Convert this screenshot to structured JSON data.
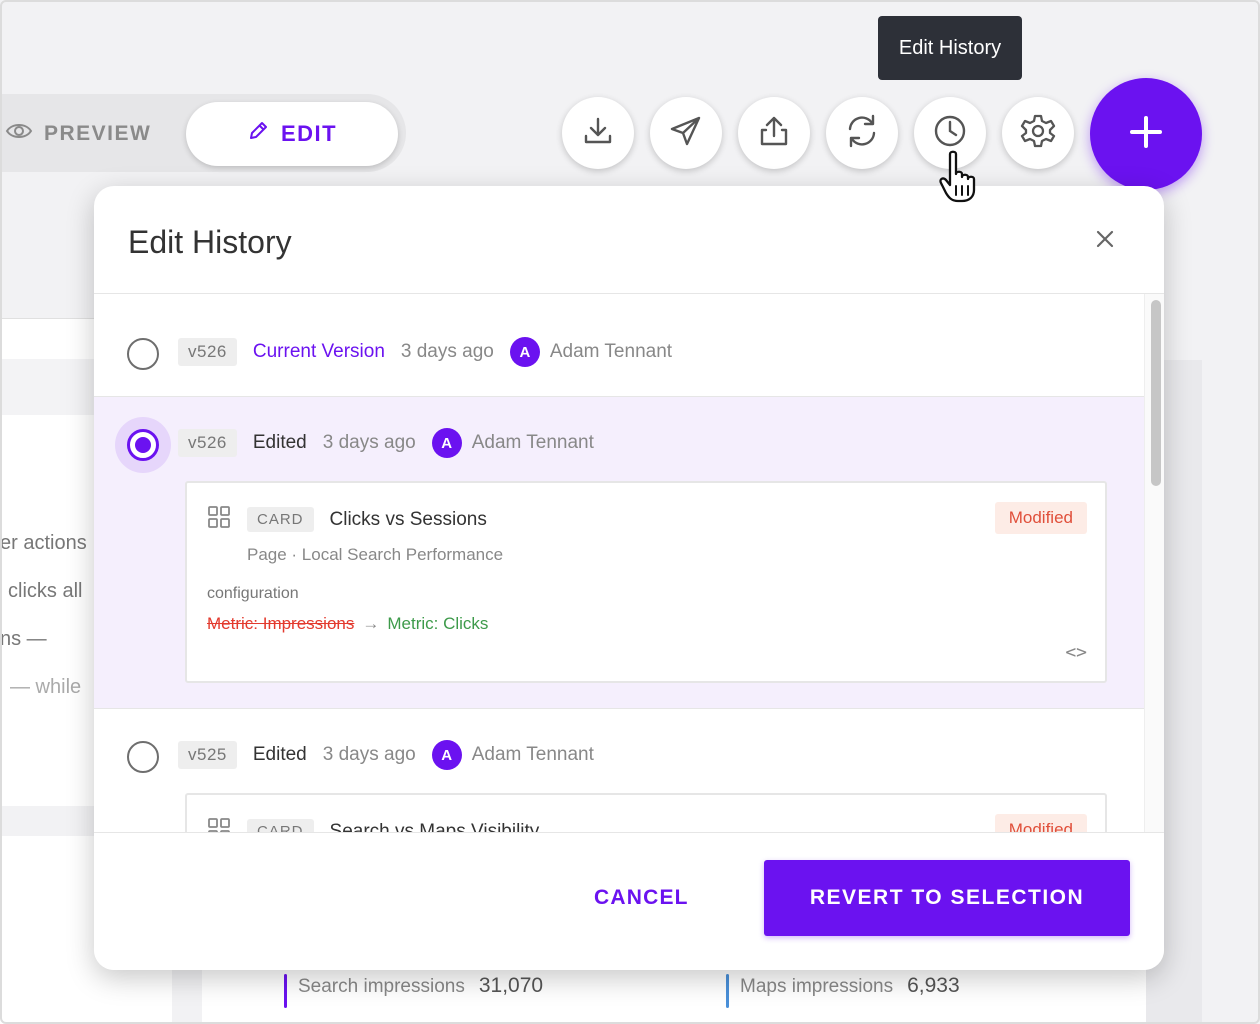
{
  "mode_toggle": {
    "preview_label": "PREVIEW",
    "edit_label": "EDIT"
  },
  "toolbar": {
    "buttons": [
      {
        "name": "download",
        "icon": "download-icon"
      },
      {
        "name": "send",
        "icon": "send-icon"
      },
      {
        "name": "share",
        "icon": "share-icon"
      },
      {
        "name": "refresh",
        "icon": "refresh-icon"
      },
      {
        "name": "edit-history",
        "icon": "clock-icon"
      },
      {
        "name": "settings",
        "icon": "gear-icon"
      }
    ],
    "fab_icon": "plus-icon",
    "tooltip": "Edit History"
  },
  "background": {
    "text_lines": [
      "er actions",
      "clicks all",
      "ns —",
      "— while"
    ],
    "metrics": [
      {
        "label": "Search impressions",
        "value": "31,070",
        "color": "#6b12f0"
      },
      {
        "label": "Maps impressions",
        "value": "6,933",
        "color": "#4a90d9"
      }
    ]
  },
  "modal": {
    "title": "Edit History",
    "entries": [
      {
        "version": "v526",
        "status": "Current Version",
        "time": "3 days ago",
        "avatar": "A",
        "author": "Adam Tennant",
        "selected": false
      },
      {
        "version": "v526",
        "status": "Edited",
        "time": "3 days ago",
        "avatar": "A",
        "author": "Adam Tennant",
        "selected": true,
        "change": {
          "type": "CARD",
          "name": "Clicks vs Sessions",
          "badge": "Modified",
          "subtitle": "Page · Local Search Performance",
          "field": "configuration",
          "old_value": "Metric: Impressions",
          "arrow": "→",
          "new_value": "Metric: Clicks",
          "code_toggle": "<>"
        }
      },
      {
        "version": "v525",
        "status": "Edited",
        "time": "3 days ago",
        "avatar": "A",
        "author": "Adam Tennant",
        "selected": false,
        "change": {
          "type": "CARD",
          "name": "Search vs Maps Visibility",
          "badge": "Modified"
        }
      }
    ],
    "footer": {
      "cancel_label": "CANCEL",
      "revert_label": "REVERT TO SELECTION"
    }
  },
  "colors": {
    "accent": "#6b12f0",
    "removed": "#e33a2e",
    "added": "#3d9a4a",
    "modified_badge": "#e04f3a"
  }
}
